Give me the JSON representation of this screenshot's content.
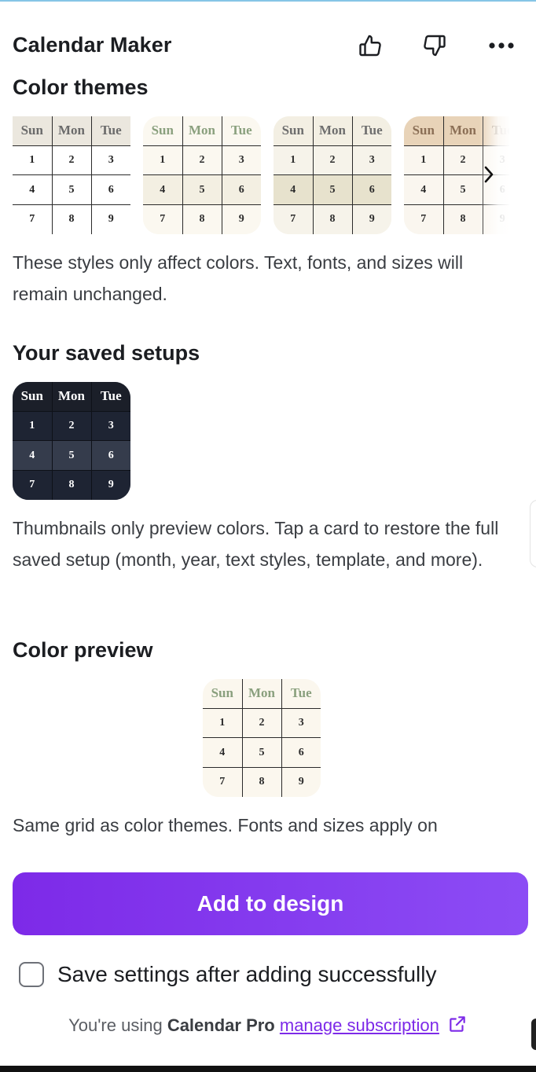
{
  "app": {
    "title": "Calendar Maker"
  },
  "header": {
    "icons": [
      "thumbs-up-icon",
      "thumbs-down-icon",
      "more-icon"
    ]
  },
  "color_themes": {
    "title": "Color themes",
    "calendar": {
      "headers": [
        "Sun",
        "Mon",
        "Tue"
      ],
      "rows": [
        [
          "1",
          "2",
          "3"
        ],
        [
          "4",
          "5",
          "6"
        ],
        [
          "7",
          "8",
          "9"
        ]
      ]
    },
    "themes": [
      {
        "header_bg": "#ebe7de",
        "cell_bg": "#ffffff",
        "header_text": "#6b6b6b"
      },
      {
        "header_bg": "#fbf8f0",
        "cell_bg": "#fbf8f0",
        "header_text": "#8aa07e"
      },
      {
        "header_bg": "#f3efe3",
        "cell_bg": "#f6f3ea",
        "header_text": "#6e6e6e"
      },
      {
        "header_bg": "#e8d3b8",
        "cell_bg": "#faf6ef",
        "header_text": "#8b6f56"
      }
    ],
    "description": "These styles only affect colors. Text, fonts, and sizes will remain unchanged."
  },
  "saved_setups": {
    "title": "Your saved setups",
    "description": "Thumbnails only preview colors. Tap a card to restore the full saved setup (month, year, text styles, template, and more)."
  },
  "color_preview": {
    "title": "Color preview",
    "description": "Same grid as color themes. Fonts and sizes apply on"
  },
  "actions": {
    "add_label": "Add to design",
    "save_settings_label": "Save settings after adding successfully",
    "save_settings_checked": false
  },
  "footer": {
    "prefix": "You're using ",
    "plan": "Calendar Pro",
    "link": "manage subscription"
  },
  "colors": {
    "accent": "#7d2ae8",
    "top_accent": "#86c5e6",
    "saved_bg": "#1c2230"
  }
}
